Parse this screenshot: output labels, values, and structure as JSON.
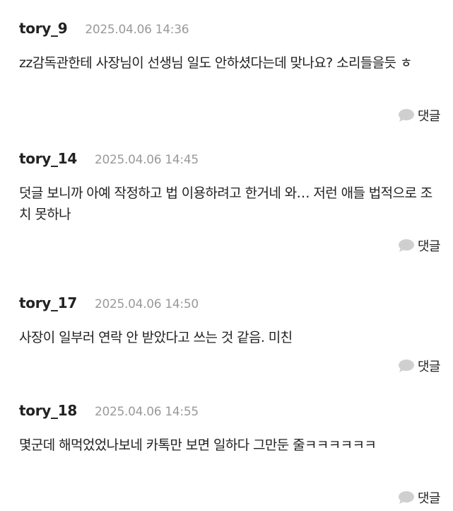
{
  "reply_label": "댓글",
  "comments": [
    {
      "username": "tory_9",
      "timestamp": "2025.04.06 14:36",
      "text": "zz감독관한테 사장님이 선생님 일도 안하셨다는데 맞나요? 소리들을듯 ㅎ"
    },
    {
      "username": "tory_14",
      "timestamp": "2025.04.06 14:45",
      "text": "덧글 보니까 아예 작정하고 법 이용하려고 한거네 와… 저런 애들 법적으로 조치 못하나"
    },
    {
      "username": "tory_17",
      "timestamp": "2025.04.06 14:50",
      "text": "사장이 일부러 연락 안 받았다고 쓰는 것 같음. 미친"
    },
    {
      "username": "tory_18",
      "timestamp": "2025.04.06 14:55",
      "text": "몇군데 해먹었었나보네 카톡만 보면 일하다 그만둔 줄ㅋㅋㅋㅋㅋㅋ"
    }
  ],
  "colors": {
    "text": "#222222",
    "timestamp": "#9a9a9a",
    "reply_icon": "#cfcfcf",
    "background": "#ffffff"
  }
}
